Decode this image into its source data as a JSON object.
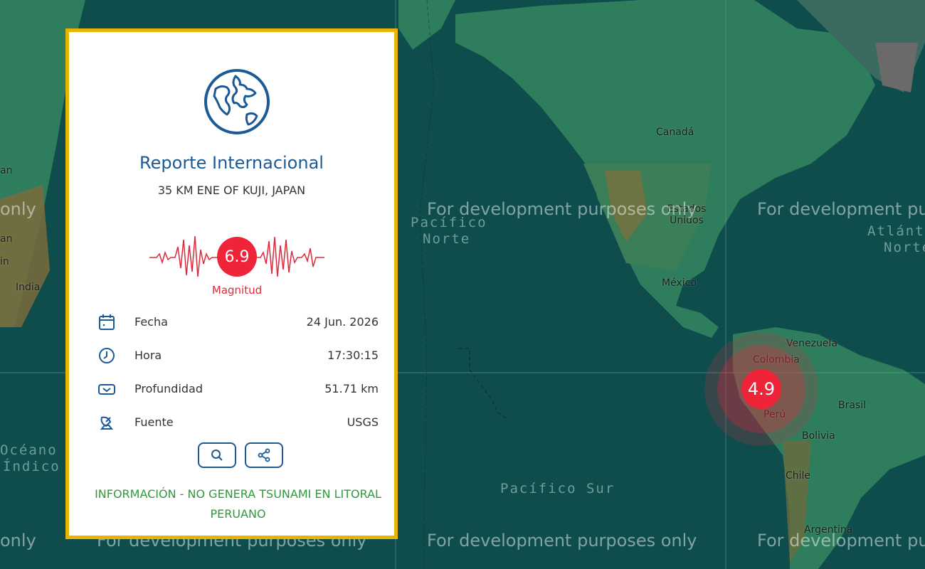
{
  "map": {
    "countries": [
      "Canadá",
      "Estados Unidos",
      "México",
      "Venezuela",
      "Colombia",
      "Perú",
      "Brasil",
      "Bolivia",
      "Chile",
      "Argentina",
      "India"
    ],
    "oceans": {
      "north_pacific": [
        "Pacífico",
        "Norte"
      ],
      "south_pacific": "Pacífico Sur",
      "atlantic": [
        "Atlánti",
        "Norte"
      ],
      "indian": [
        "Océano",
        "Índico"
      ]
    },
    "watermark": "For development purposes only",
    "watermark_fragments": [
      "only",
      "only",
      "an",
      "an",
      "in"
    ],
    "event_marker": {
      "magnitude": "4.9",
      "color": "#ef2439"
    }
  },
  "card": {
    "border_color": "#e8b400",
    "globe_icon": "globe-icon",
    "title": "Reporte Internacional",
    "location": "35 KM ENE OF KUJI, JAPAN",
    "magnitude": "6.9",
    "magnitude_label": "Magnitud",
    "details": [
      {
        "icon": "calendar-icon",
        "label": "Fecha",
        "value": "24 Jun. 2026"
      },
      {
        "icon": "clock-icon",
        "label": "Hora",
        "value": "17:30:15"
      },
      {
        "icon": "depth-icon",
        "label": "Profundidad",
        "value": "51.71 km"
      },
      {
        "icon": "satellite-dish-icon",
        "label": "Fuente",
        "value": "USGS"
      }
    ],
    "actions": [
      {
        "icon": "search-icon"
      },
      {
        "icon": "share-icon"
      }
    ],
    "notice": "INFORMACIÓN - NO GENERA TSUNAMI EN LITORAL PERUANO",
    "colors": {
      "title": "#1b5a96",
      "magnitude": "#ef2439",
      "notice": "#2f9a3c"
    }
  }
}
